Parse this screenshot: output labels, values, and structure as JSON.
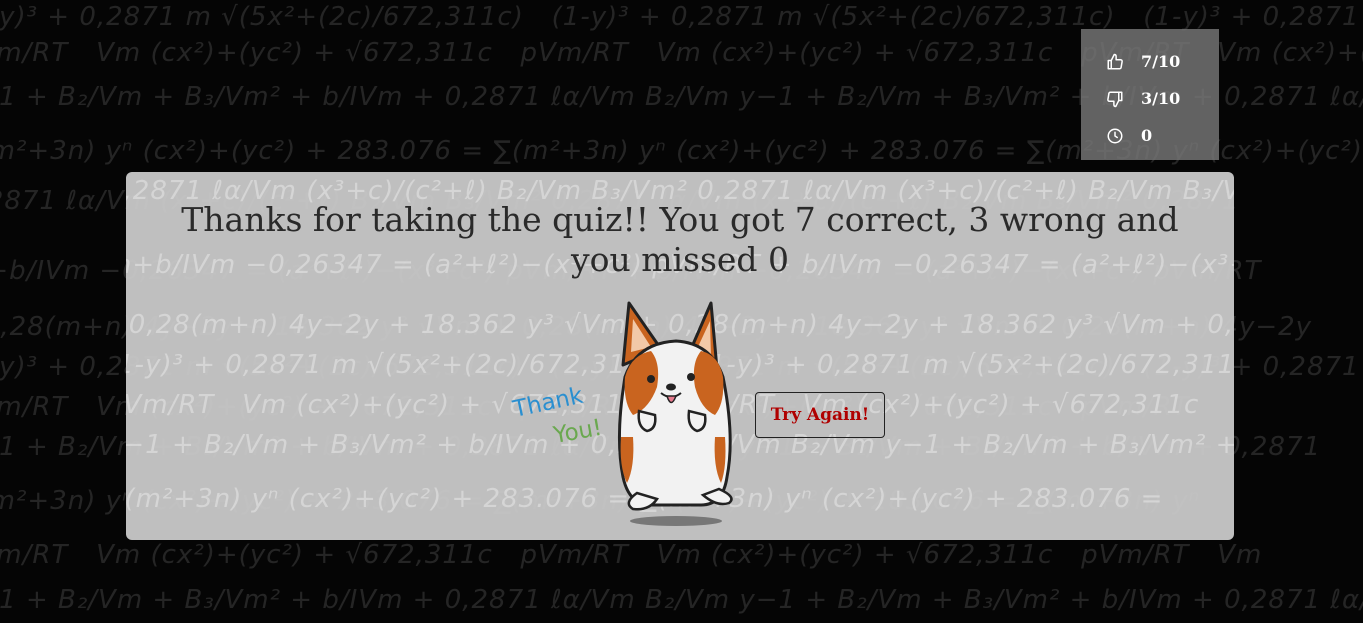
{
  "score": {
    "correct": "7/10",
    "wrong": "3/10",
    "missed": "0",
    "icons": [
      "thumbs-up-icon",
      "thumbs-down-icon",
      "clock-icon"
    ]
  },
  "result": {
    "message": "Thanks for taking the quiz!! You got 7 correct, 3 wrong and you missed 0",
    "illustration_text_line1": "Thank",
    "illustration_text_line2": "You!",
    "try_again_label": "Try Again!"
  },
  "colors": {
    "background": "#050505",
    "panel": "#cdcdcd",
    "score_panel": "#787878",
    "button_text": "#b00000",
    "thank_blue": "#2a8fd0",
    "you_green": "#6aa84f",
    "corgi_orange": "#c9641f"
  }
}
